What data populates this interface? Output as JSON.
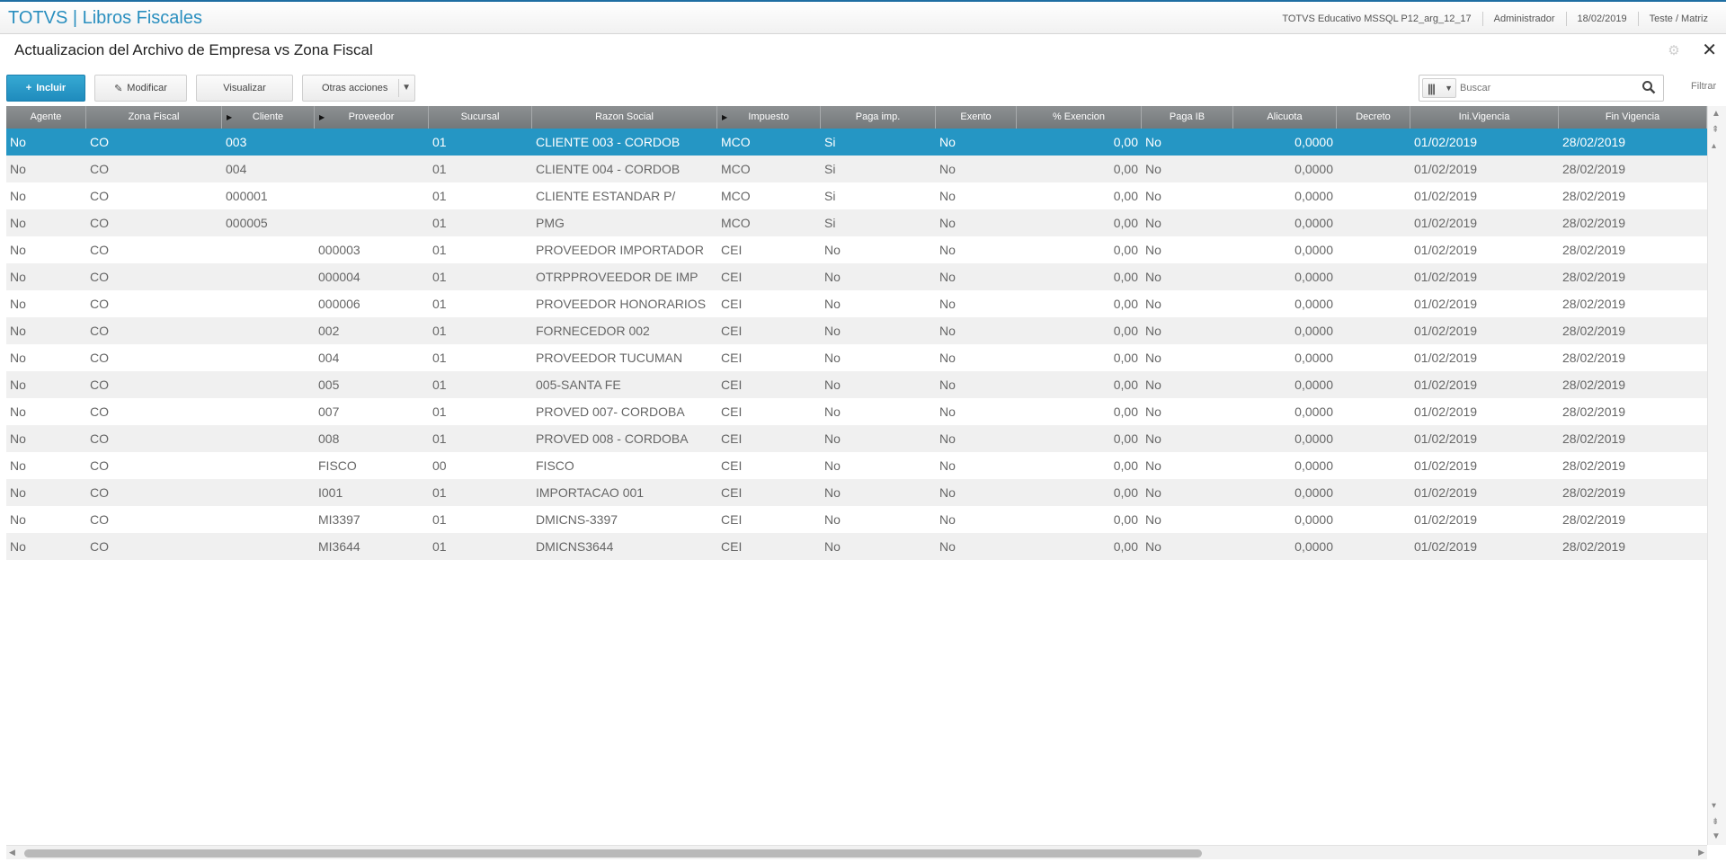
{
  "header": {
    "app_title": "TOTVS | Libros Fiscales",
    "environment": "TOTVS Educativo MSSQL P12_arg_12_17",
    "user": "Administrador",
    "date": "18/02/2019",
    "branch": "Teste / Matriz"
  },
  "page": {
    "title": "Actualizacion del Archivo de Empresa vs Zona Fiscal"
  },
  "toolbar": {
    "incluir": "Incluir",
    "modificar": "Modificar",
    "visualizar": "Visualizar",
    "otras_acciones": "Otras acciones"
  },
  "search": {
    "placeholder": "Buscar",
    "value": "Buscar",
    "filter_label": "Filtrar"
  },
  "table": {
    "columns": [
      "Agente",
      "Zona Fiscal",
      "Cliente",
      "Proveedor",
      "Sucursal",
      "Razon Social",
      "Impuesto",
      "Paga imp.",
      "Exento",
      "% Exencion",
      "Paga IB",
      "Alicuota",
      "Decreto",
      "Ini.Vigencia",
      "Fin Vigencia"
    ],
    "rows": [
      [
        "No",
        "CO",
        "003",
        "",
        "01",
        "CLIENTE 003 - CORDOB",
        "MCO",
        "Si",
        "No",
        "0,00",
        "No",
        "0,0000",
        "",
        "01/02/2019",
        "28/02/2019"
      ],
      [
        "No",
        "CO",
        "004",
        "",
        "01",
        "CLIENTE 004 - CORDOB",
        "MCO",
        "Si",
        "No",
        "0,00",
        "No",
        "0,0000",
        "",
        "01/02/2019",
        "28/02/2019"
      ],
      [
        "No",
        "CO",
        "000001",
        "",
        "01",
        "CLIENTE ESTANDAR P/",
        "MCO",
        "Si",
        "No",
        "0,00",
        "No",
        "0,0000",
        "",
        "01/02/2019",
        "28/02/2019"
      ],
      [
        "No",
        "CO",
        "000005",
        "",
        "01",
        "PMG",
        "MCO",
        "Si",
        "No",
        "0,00",
        "No",
        "0,0000",
        "",
        "01/02/2019",
        "28/02/2019"
      ],
      [
        "No",
        "CO",
        "",
        "000003",
        "01",
        "PROVEEDOR IMPORTADOR",
        "CEI",
        "No",
        "No",
        "0,00",
        "No",
        "0,0000",
        "",
        "01/02/2019",
        "28/02/2019"
      ],
      [
        "No",
        "CO",
        "",
        "000004",
        "01",
        "OTRPPROVEEDOR DE IMP",
        "CEI",
        "No",
        "No",
        "0,00",
        "No",
        "0,0000",
        "",
        "01/02/2019",
        "28/02/2019"
      ],
      [
        "No",
        "CO",
        "",
        "000006",
        "01",
        "PROVEEDOR HONORARIOS",
        "CEI",
        "No",
        "No",
        "0,00",
        "No",
        "0,0000",
        "",
        "01/02/2019",
        "28/02/2019"
      ],
      [
        "No",
        "CO",
        "",
        "002",
        "01",
        "FORNECEDOR 002",
        "CEI",
        "No",
        "No",
        "0,00",
        "No",
        "0,0000",
        "",
        "01/02/2019",
        "28/02/2019"
      ],
      [
        "No",
        "CO",
        "",
        "004",
        "01",
        "PROVEEDOR TUCUMAN",
        "CEI",
        "No",
        "No",
        "0,00",
        "No",
        "0,0000",
        "",
        "01/02/2019",
        "28/02/2019"
      ],
      [
        "No",
        "CO",
        "",
        "005",
        "01",
        "005-SANTA FE",
        "CEI",
        "No",
        "No",
        "0,00",
        "No",
        "0,0000",
        "",
        "01/02/2019",
        "28/02/2019"
      ],
      [
        "No",
        "CO",
        "",
        "007",
        "01",
        "PROVED 007- CORDOBA",
        "CEI",
        "No",
        "No",
        "0,00",
        "No",
        "0,0000",
        "",
        "01/02/2019",
        "28/02/2019"
      ],
      [
        "No",
        "CO",
        "",
        "008",
        "01",
        "PROVED 008 - CORDOBA",
        "CEI",
        "No",
        "No",
        "0,00",
        "No",
        "0,0000",
        "",
        "01/02/2019",
        "28/02/2019"
      ],
      [
        "No",
        "CO",
        "",
        "FISCO",
        "00",
        "FISCO",
        "CEI",
        "No",
        "No",
        "0,00",
        "No",
        "0,0000",
        "",
        "01/02/2019",
        "28/02/2019"
      ],
      [
        "No",
        "CO",
        "",
        "I001",
        "01",
        "IMPORTACAO 001",
        "CEI",
        "No",
        "No",
        "0,00",
        "No",
        "0,0000",
        "",
        "01/02/2019",
        "28/02/2019"
      ],
      [
        "No",
        "CO",
        "",
        "MI3397",
        "01",
        "DMICNS-3397",
        "CEI",
        "No",
        "No",
        "0,00",
        "No",
        "0,0000",
        "",
        "01/02/2019",
        "28/02/2019"
      ],
      [
        "No",
        "CO",
        "",
        "MI3644",
        "01",
        "DMICNS3644",
        "CEI",
        "No",
        "No",
        "0,00",
        "No",
        "0,0000",
        "",
        "01/02/2019",
        "28/02/2019"
      ]
    ],
    "selected_row": 0
  },
  "colors": {
    "accent": "#2a8fbf",
    "primary_button": "#1f8bbd",
    "selected_row": "#2596c4",
    "header_bg": "#7e8284"
  },
  "icons": [
    "plus-icon",
    "pencil-icon",
    "columns-icon",
    "search-icon",
    "gear-icon",
    "close-icon",
    "sort-marker-icon"
  ]
}
